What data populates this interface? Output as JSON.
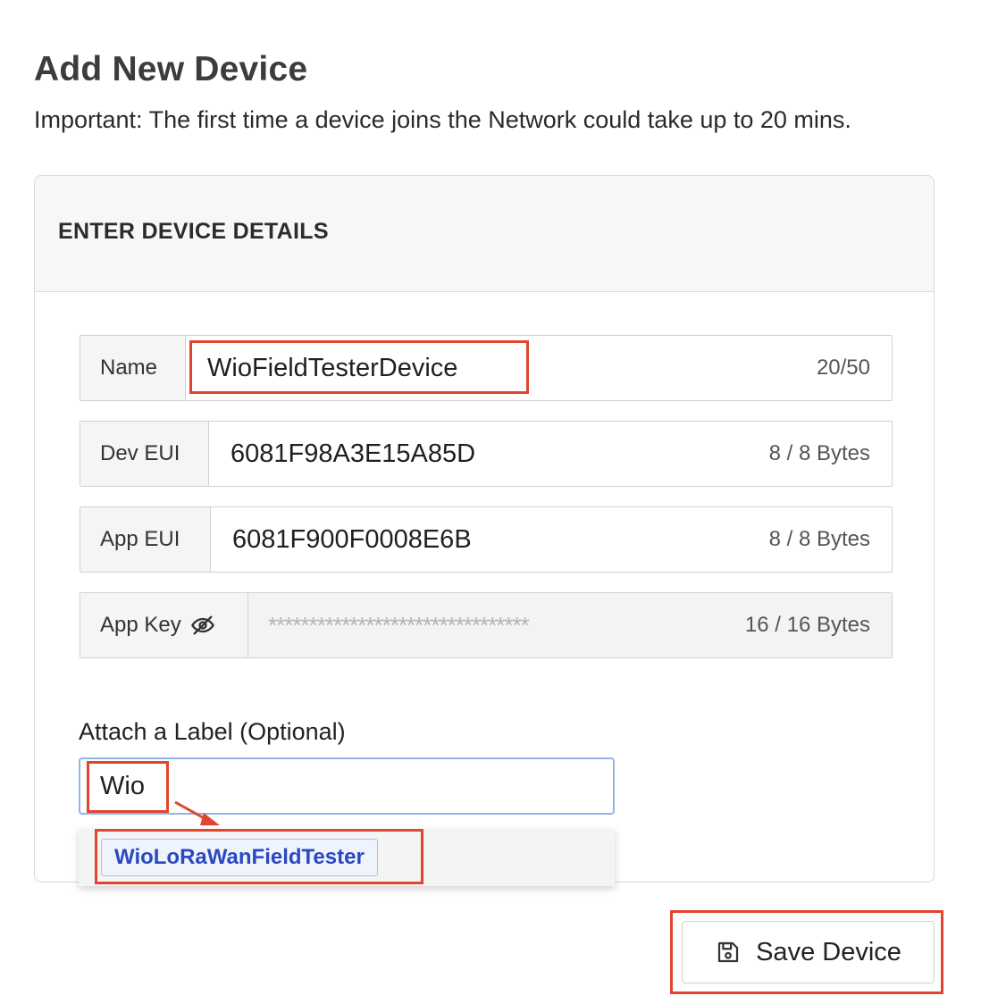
{
  "page": {
    "title": "Add New Device",
    "notice_strong": "Important:",
    "notice_text": " The first time a device joins the Network could take up to 20 mins."
  },
  "panel": {
    "header": "ENTER DEVICE DETAILS"
  },
  "fields": {
    "name": {
      "label": "Name",
      "value": "WioFieldTesterDevice",
      "counter": "20/50"
    },
    "dev_eui": {
      "label": "Dev EUI",
      "value": "6081F98A3E15A85D",
      "counter": "8 / 8 Bytes"
    },
    "app_eui": {
      "label": "App EUI",
      "value": "6081F900F0008E6B",
      "counter": "8 / 8 Bytes"
    },
    "app_key": {
      "label": "App Key",
      "value": "********************************",
      "counter": "16 / 16 Bytes",
      "icon": "eye-slash-icon"
    }
  },
  "label_section": {
    "heading": "Attach a Label (Optional)",
    "input_value": "Wio",
    "suggestion": "WioLoRaWanFieldTester"
  },
  "actions": {
    "save_label": "Save Device",
    "save_icon": "floppy-disk-icon"
  },
  "colors": {
    "highlight": "#e0452d",
    "chip_text": "#2b48c0",
    "input_focus_border": "#8fb5e8"
  }
}
